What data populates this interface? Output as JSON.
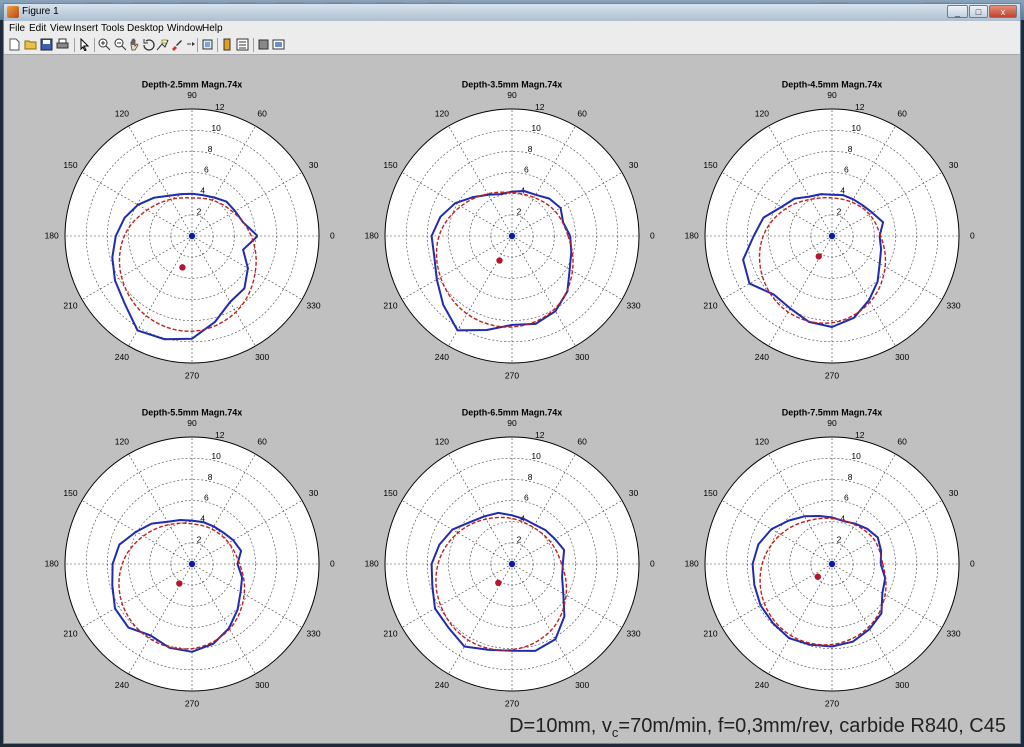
{
  "window": {
    "title": "Figure 1",
    "controls": [
      "_",
      "□",
      "x"
    ]
  },
  "menu": [
    "File",
    "Edit",
    "View",
    "Insert",
    "Tools",
    "Desktop",
    "Window",
    "Help"
  ],
  "toolbar_icons": [
    "new-file-icon",
    "open-folder-icon",
    "save-icon",
    "print-icon",
    "pointer-icon",
    "zoom-in-icon",
    "zoom-out-icon",
    "pan-hand-icon",
    "rotate-3d-icon",
    "data-cursor-icon",
    "brush-icon",
    "link-plot-icon",
    "colorbar-icon",
    "legend-icon",
    "hide-plot-tools-icon",
    "show-plot-tools-icon"
  ],
  "caption": {
    "prefix": "D=10mm, v",
    "sub": "c",
    "suffix": "=70m/min, f=0,3mm/rev, carbide R840, C45"
  },
  "colors": {
    "measured": "#1f2bb0",
    "fit": "#c0201c",
    "grid": "#444444",
    "center_dot": "#0a1aa8",
    "offset_dot": "#b5162d"
  },
  "chart_data": [
    {
      "type": "polar",
      "title": "Depth-2.5mm  Magn.74x",
      "angle_ticks": [
        "0",
        "30",
        "60",
        "90",
        "120",
        "150",
        "180",
        "210",
        "240",
        "270",
        "300",
        "330"
      ],
      "radial_ticks": [
        "2",
        "4",
        "6",
        "8",
        "10",
        "12"
      ],
      "rlim": [
        0,
        12
      ],
      "grid": true,
      "series": [
        {
          "style": "solid-blue",
          "theta": [
            0,
            15,
            30,
            45,
            60,
            75,
            90,
            105,
            120,
            135,
            150,
            165,
            180,
            195,
            210,
            225,
            240,
            255,
            270,
            285,
            300,
            315,
            330,
            345
          ],
          "r": [
            6.2,
            5.0,
            4.7,
            4.6,
            4.2,
            4.0,
            4.0,
            4.1,
            4.4,
            5.1,
            5.9,
            6.6,
            7.2,
            7.8,
            8.4,
            9.0,
            10.3,
            10.1,
            9.7,
            8.4,
            7.2,
            7.0,
            6.1,
            5.0
          ]
        },
        {
          "style": "dashed-red",
          "theta": [
            0,
            30,
            60,
            90,
            120,
            150,
            180,
            210,
            240,
            270,
            300,
            330
          ],
          "r": [
            5.6,
            4.5,
            3.9,
            3.6,
            4.0,
            4.9,
            6.4,
            7.7,
            8.7,
            9.0,
            8.3,
            6.9
          ]
        }
      ],
      "points": [
        {
          "theta": 0,
          "r": 0,
          "style": "blue-dot"
        },
        {
          "theta": 253,
          "r": 3.1,
          "style": "red-dot"
        }
      ]
    },
    {
      "type": "polar",
      "title": "Depth-3.5mm  Magn.74x",
      "angle_ticks": [
        "0",
        "30",
        "60",
        "90",
        "120",
        "150",
        "180",
        "210",
        "240",
        "270",
        "300",
        "330"
      ],
      "radial_ticks": [
        "2",
        "4",
        "6",
        "8",
        "10",
        "12"
      ],
      "rlim": [
        0,
        12
      ],
      "grid": true,
      "series": [
        {
          "style": "solid-blue",
          "theta": [
            0,
            15,
            30,
            45,
            60,
            75,
            90,
            105,
            120,
            135,
            150,
            165,
            180,
            195,
            210,
            225,
            240,
            255,
            270,
            285,
            300,
            315,
            330,
            345
          ],
          "r": [
            5.5,
            5.0,
            5.3,
            5.0,
            4.5,
            4.4,
            4.2,
            4.1,
            4.5,
            5.2,
            6.2,
            7.0,
            7.6,
            7.6,
            8.2,
            9.2,
            10.3,
            9.2,
            8.4,
            8.6,
            8.2,
            7.4,
            6.3,
            5.8
          ]
        },
        {
          "style": "dashed-red",
          "theta": [
            0,
            30,
            60,
            90,
            120,
            150,
            180,
            210,
            240,
            270,
            300,
            330
          ],
          "r": [
            5.3,
            4.7,
            4.2,
            4.1,
            4.6,
            5.6,
            6.9,
            7.8,
            8.5,
            8.6,
            8.0,
            6.6
          ]
        }
      ],
      "points": [
        {
          "theta": 0,
          "r": 0,
          "style": "blue-dot"
        },
        {
          "theta": 243,
          "r": 2.6,
          "style": "red-dot"
        }
      ]
    },
    {
      "type": "polar",
      "title": "Depth-4.5mm  Magn.74x",
      "angle_ticks": [
        "0",
        "30",
        "60",
        "90",
        "120",
        "150",
        "180",
        "210",
        "240",
        "270",
        "300",
        "330"
      ],
      "radial_ticks": [
        "2",
        "4",
        "6",
        "8",
        "10",
        "12"
      ],
      "rlim": [
        0,
        12
      ],
      "grid": true,
      "series": [
        {
          "style": "solid-blue",
          "theta": [
            0,
            15,
            30,
            45,
            60,
            75,
            90,
            105,
            120,
            135,
            150,
            165,
            180,
            195,
            210,
            225,
            240,
            255,
            270,
            285,
            300,
            315,
            330,
            345
          ],
          "r": [
            4.5,
            5.0,
            4.4,
            4.1,
            4.0,
            4.0,
            3.9,
            4.1,
            4.3,
            5.0,
            5.5,
            6.7,
            7.4,
            8.7,
            9.0,
            7.8,
            7.9,
            8.4,
            8.6,
            8.0,
            7.0,
            6.1,
            5.2,
            4.8
          ]
        },
        {
          "style": "dashed-red",
          "theta": [
            0,
            30,
            60,
            90,
            120,
            150,
            180,
            210,
            240,
            270,
            300,
            330
          ],
          "r": [
            4.6,
            4.1,
            3.7,
            3.6,
            4.0,
            5.1,
            6.5,
            7.6,
            8.3,
            8.2,
            7.2,
            5.8
          ]
        }
      ],
      "points": [
        {
          "theta": 0,
          "r": 0,
          "style": "blue-dot"
        },
        {
          "theta": 237,
          "r": 2.3,
          "style": "red-dot"
        }
      ]
    },
    {
      "type": "polar",
      "title": "Depth-5.5mm  Magn.74x",
      "angle_ticks": [
        "0",
        "30",
        "60",
        "90",
        "120",
        "150",
        "180",
        "210",
        "240",
        "270",
        "300",
        "330"
      ],
      "radial_ticks": [
        "2",
        "4",
        "6",
        "8",
        "10",
        "12"
      ],
      "rlim": [
        0,
        12
      ],
      "grid": true,
      "series": [
        {
          "style": "solid-blue",
          "theta": [
            0,
            15,
            30,
            45,
            60,
            75,
            90,
            105,
            120,
            135,
            150,
            165,
            180,
            195,
            210,
            225,
            240,
            255,
            270,
            285,
            300,
            315,
            330,
            345
          ],
          "r": [
            4.3,
            4.8,
            4.5,
            4.2,
            4.1,
            4.1,
            4.1,
            4.3,
            4.6,
            5.4,
            6.1,
            7.1,
            7.5,
            7.8,
            8.4,
            8.5,
            7.8,
            8.2,
            8.3,
            7.8,
            7.0,
            6.1,
            5.3,
            4.9
          ]
        },
        {
          "style": "dashed-red",
          "theta": [
            0,
            30,
            60,
            90,
            120,
            150,
            180,
            210,
            240,
            270,
            300,
            330
          ],
          "r": [
            4.5,
            4.0,
            3.8,
            3.8,
            4.3,
            5.3,
            6.6,
            7.6,
            8.1,
            8.0,
            7.1,
            5.7
          ]
        }
      ],
      "points": [
        {
          "theta": 0,
          "r": 0,
          "style": "blue-dot"
        },
        {
          "theta": 237,
          "r": 2.2,
          "style": "red-dot"
        }
      ]
    },
    {
      "type": "polar",
      "title": "Depth-6.5mm  Magn.74x",
      "angle_ticks": [
        "0",
        "30",
        "60",
        "90",
        "120",
        "150",
        "180",
        "210",
        "240",
        "270",
        "300",
        "330"
      ],
      "radial_ticks": [
        "2",
        "4",
        "6",
        "8",
        "10",
        "12"
      ],
      "rlim": [
        0,
        12
      ],
      "grid": true,
      "series": [
        {
          "style": "solid-blue",
          "theta": [
            0,
            15,
            30,
            45,
            60,
            75,
            90,
            105,
            120,
            135,
            150,
            165,
            180,
            195,
            210,
            225,
            240,
            255,
            270,
            285,
            300,
            315,
            330,
            345
          ],
          "r": [
            4.8,
            5.1,
            4.7,
            4.5,
            4.3,
            4.4,
            4.6,
            5.0,
            5.2,
            5.6,
            6.5,
            7.1,
            7.6,
            7.8,
            8.4,
            8.5,
            9.0,
            8.4,
            8.2,
            8.5,
            8.2,
            7.0,
            5.6,
            4.9
          ]
        },
        {
          "style": "dashed-red",
          "theta": [
            0,
            30,
            60,
            90,
            120,
            150,
            180,
            210,
            240,
            270,
            300,
            330
          ],
          "r": [
            4.7,
            4.2,
            4.0,
            4.3,
            4.9,
            5.9,
            7.0,
            7.8,
            8.3,
            8.1,
            7.3,
            5.9
          ]
        }
      ],
      "points": [
        {
          "theta": 0,
          "r": 0,
          "style": "blue-dot"
        },
        {
          "theta": 234,
          "r": 2.2,
          "style": "red-dot"
        }
      ]
    },
    {
      "type": "polar",
      "title": "Depth-7.5mm  Magn.74x",
      "angle_ticks": [
        "0",
        "30",
        "60",
        "90",
        "120",
        "150",
        "180",
        "210",
        "240",
        "270",
        "300",
        "330"
      ],
      "radial_ticks": [
        "2",
        "4",
        "6",
        "8",
        "10",
        "12"
      ],
      "rlim": [
        0,
        12
      ],
      "grid": true,
      "series": [
        {
          "style": "solid-blue",
          "theta": [
            0,
            15,
            30,
            45,
            60,
            75,
            90,
            105,
            120,
            135,
            150,
            165,
            180,
            195,
            210,
            225,
            240,
            255,
            270,
            285,
            300,
            315,
            330,
            345
          ],
          "r": [
            4.6,
            4.8,
            5.0,
            4.7,
            4.4,
            4.2,
            4.4,
            4.7,
            5.2,
            5.8,
            6.6,
            7.2,
            7.5,
            7.6,
            7.8,
            7.9,
            8.1,
            7.9,
            7.8,
            7.6,
            7.1,
            6.6,
            5.5,
            5.2
          ]
        },
        {
          "style": "dashed-red",
          "theta": [
            0,
            30,
            60,
            90,
            120,
            150,
            180,
            210,
            240,
            270,
            300,
            330
          ],
          "r": [
            4.8,
            4.6,
            4.3,
            4.3,
            4.7,
            5.6,
            6.6,
            7.4,
            7.8,
            7.6,
            6.9,
            5.8
          ]
        }
      ],
      "points": [
        {
          "theta": 0,
          "r": 0,
          "style": "blue-dot"
        },
        {
          "theta": 222,
          "r": 1.8,
          "style": "red-dot"
        }
      ]
    }
  ]
}
